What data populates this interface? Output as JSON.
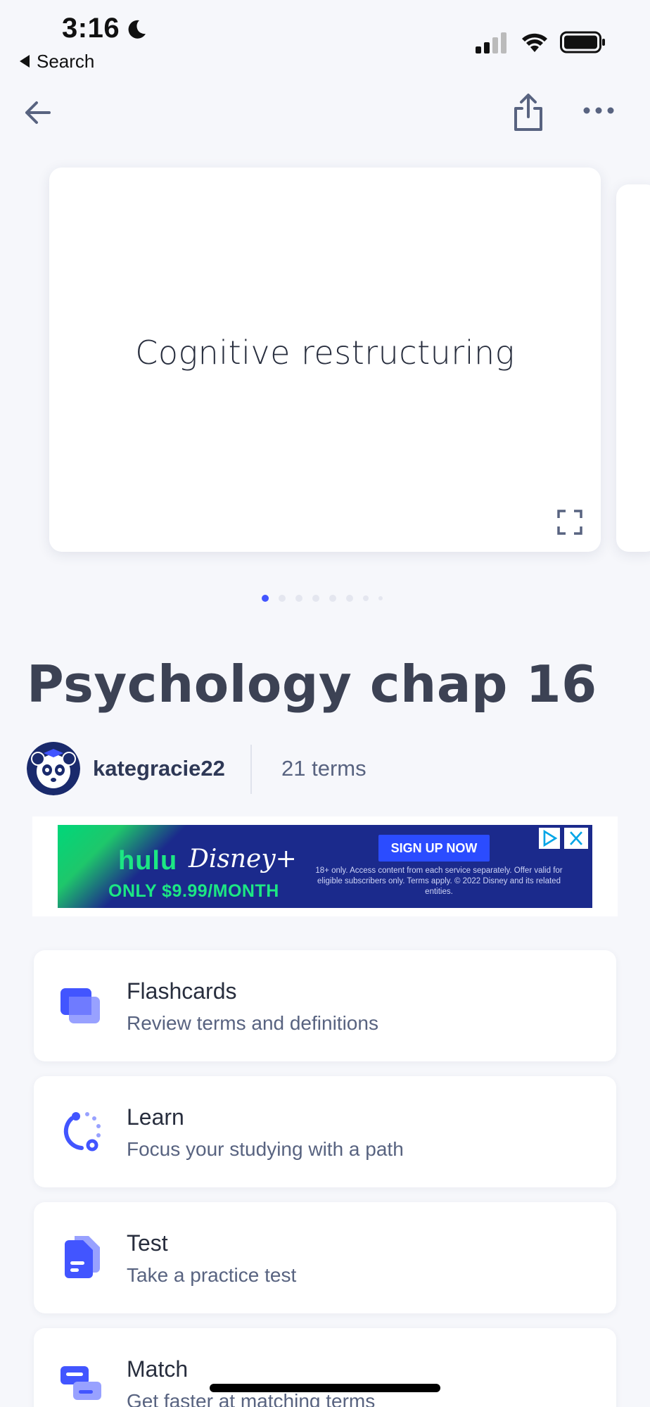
{
  "status_bar": {
    "time": "3:16",
    "back_app_label": "Search"
  },
  "card": {
    "term": "Cognitive restructuring"
  },
  "set": {
    "title": "Psychology chap 16",
    "author": "kategracie22",
    "term_count": "21 terms"
  },
  "ad": {
    "brand_hulu": "hulu",
    "brand_disney": "Disney+",
    "price": "ONLY $9.99/MONTH",
    "cta": "SIGN UP NOW",
    "fine_print": "18+ only. Access content from each service separately. Offer valid for eligible subscribers only. Terms apply. © 2022 Disney and its related entities."
  },
  "modes": [
    {
      "title": "Flashcards",
      "subtitle": "Review terms and definitions"
    },
    {
      "title": "Learn",
      "subtitle": "Focus your studying with a path"
    },
    {
      "title": "Test",
      "subtitle": "Take a practice test"
    },
    {
      "title": "Match",
      "subtitle": "Get faster at matching terms"
    }
  ],
  "colors": {
    "accent": "#4255ff",
    "background": "#f6f7fb",
    "title_text": "#3c4254",
    "secondary_text": "#586380"
  },
  "icons": {
    "nav_back": "arrow-left-icon",
    "nav_share": "share-icon",
    "nav_more": "more-horizontal-icon",
    "card_expand": "expand-icon"
  }
}
